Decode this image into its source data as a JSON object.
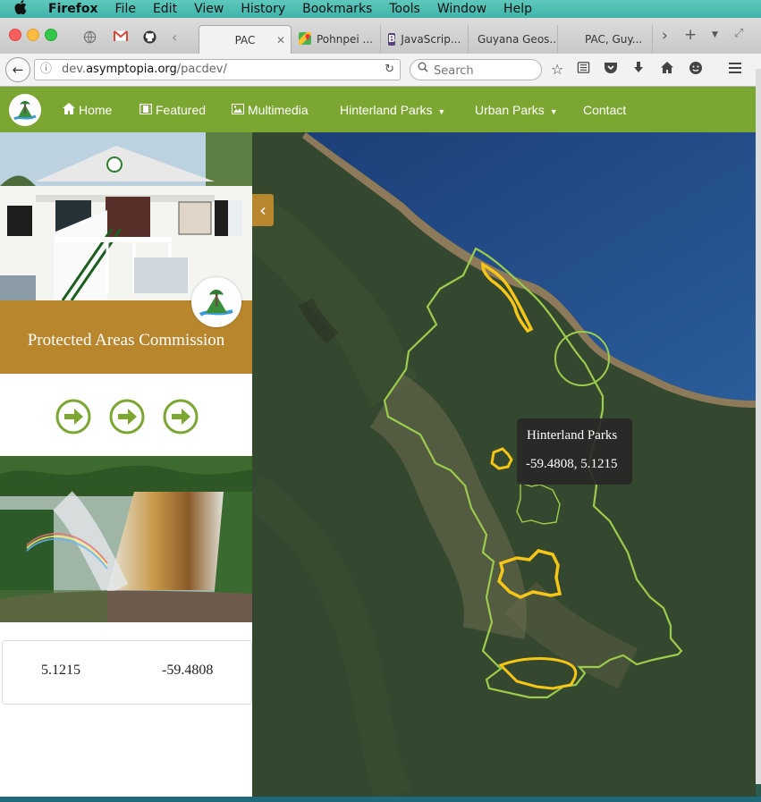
{
  "menubar": {
    "apple": "",
    "items": [
      "Firefox",
      "File",
      "Edit",
      "View",
      "History",
      "Bookmarks",
      "Tools",
      "Window",
      "Help"
    ]
  },
  "tabs": [
    {
      "label": "PAC",
      "active": true
    },
    {
      "label": "Pohnpei ..."
    },
    {
      "label": "JavaScrip..."
    },
    {
      "label": "Guyana Geos..."
    },
    {
      "label": "PAC, Guy..."
    }
  ],
  "addressbar": {
    "url_prefix": "dev.",
    "url_domain": "asymptopia.org",
    "url_path": "/pacdev/",
    "search_placeholder": "Search"
  },
  "site": {
    "nav": [
      {
        "label": "Home",
        "icon": "home-icon"
      },
      {
        "label": "Featured",
        "icon": "film-icon"
      },
      {
        "label": "Multimedia",
        "icon": "picture-icon"
      },
      {
        "label": "Hinterland Parks",
        "icon": "caret-down-icon"
      },
      {
        "label": "Urban Parks",
        "icon": "caret-down-icon"
      },
      {
        "label": "Contact"
      }
    ],
    "sidebar_title": "Protected Areas Commission",
    "latitude": "5.1215",
    "longitude": "-59.4808"
  },
  "map": {
    "tooltip_title": "Hinterland Parks",
    "tooltip_coords": "-59.4808, 5.1215",
    "collapse_icon": "chevron-left-icon"
  },
  "colors": {
    "nav_green": "#7aa631",
    "band_gold": "#b8862d",
    "park_yellow": "#f5c518",
    "border_green": "#9ccc4c"
  }
}
